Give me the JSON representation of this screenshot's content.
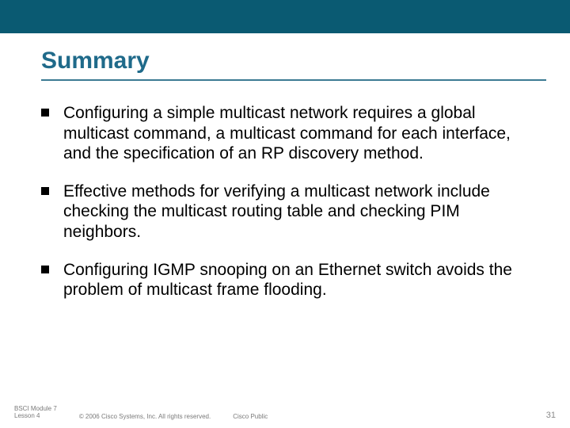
{
  "title": "Summary",
  "bullets": [
    "Configuring a simple multicast network requires a global multicast command, a multicast command for each interface, and the specification of an RP discovery method.",
    "Effective methods for verifying a multicast network include checking the multicast routing table and checking PIM neighbors.",
    "Configuring IGMP snooping on an Ethernet switch avoids the problem of multicast frame flooding."
  ],
  "footer": {
    "module_line1": "BSCI Module 7",
    "module_line2": "Lesson 4",
    "copyright": "© 2006 Cisco Systems, Inc. All rights reserved.",
    "classification": "Cisco Public",
    "page": "31"
  }
}
